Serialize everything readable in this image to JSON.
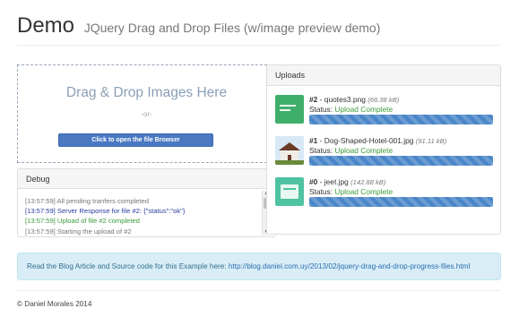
{
  "header": {
    "title": "Demo",
    "subtitle": "JQuery Drag and Drop Files (w/image preview demo)"
  },
  "dropzone": {
    "title": "Drag & Drop Images Here",
    "or_text": "-or-",
    "button_label": "Click to open the file Browser"
  },
  "debug": {
    "heading": "Debug",
    "lines": [
      "[13:57:59] All pending tranfers completed",
      "[13:57:59] Server Response for file #2: {\"status\":\"ok\"}",
      "[13:57:59] Upload of file #2 completed",
      "[13:57:59] Starting the upload of #2"
    ]
  },
  "uploads": {
    "heading": "Uploads",
    "status_label": "Status:",
    "items": [
      {
        "id": "#2",
        "name": "quotes3.png",
        "size": "(66.38 kB)",
        "status": "Upload Complete",
        "progress": 1.0
      },
      {
        "id": "#1",
        "name": "Dog-Shaped-Hotel-001.jpg",
        "size": "(91.11 kB)",
        "status": "Upload Complete",
        "progress": 1.0
      },
      {
        "id": "#0",
        "name": "jeet.jpg",
        "size": "(142.88 kB)",
        "status": "Upload Complete",
        "progress": 1.0
      }
    ]
  },
  "info": {
    "text": "Read the Blog Article and Source code for this Example here:",
    "link": "http://blog.daniel.com.uy/2013/02/jquery-drag-and-drop-progress-files.html"
  },
  "footer": {
    "copyright": "© Daniel Morales 2014"
  },
  "colors": {
    "progress": "#4a86c8",
    "status_ok": "#3c9a3c",
    "info_bg": "#d9edf7"
  },
  "icons": {
    "scroll_up": "triangle-up-icon",
    "scroll_down": "triangle-down-icon"
  }
}
